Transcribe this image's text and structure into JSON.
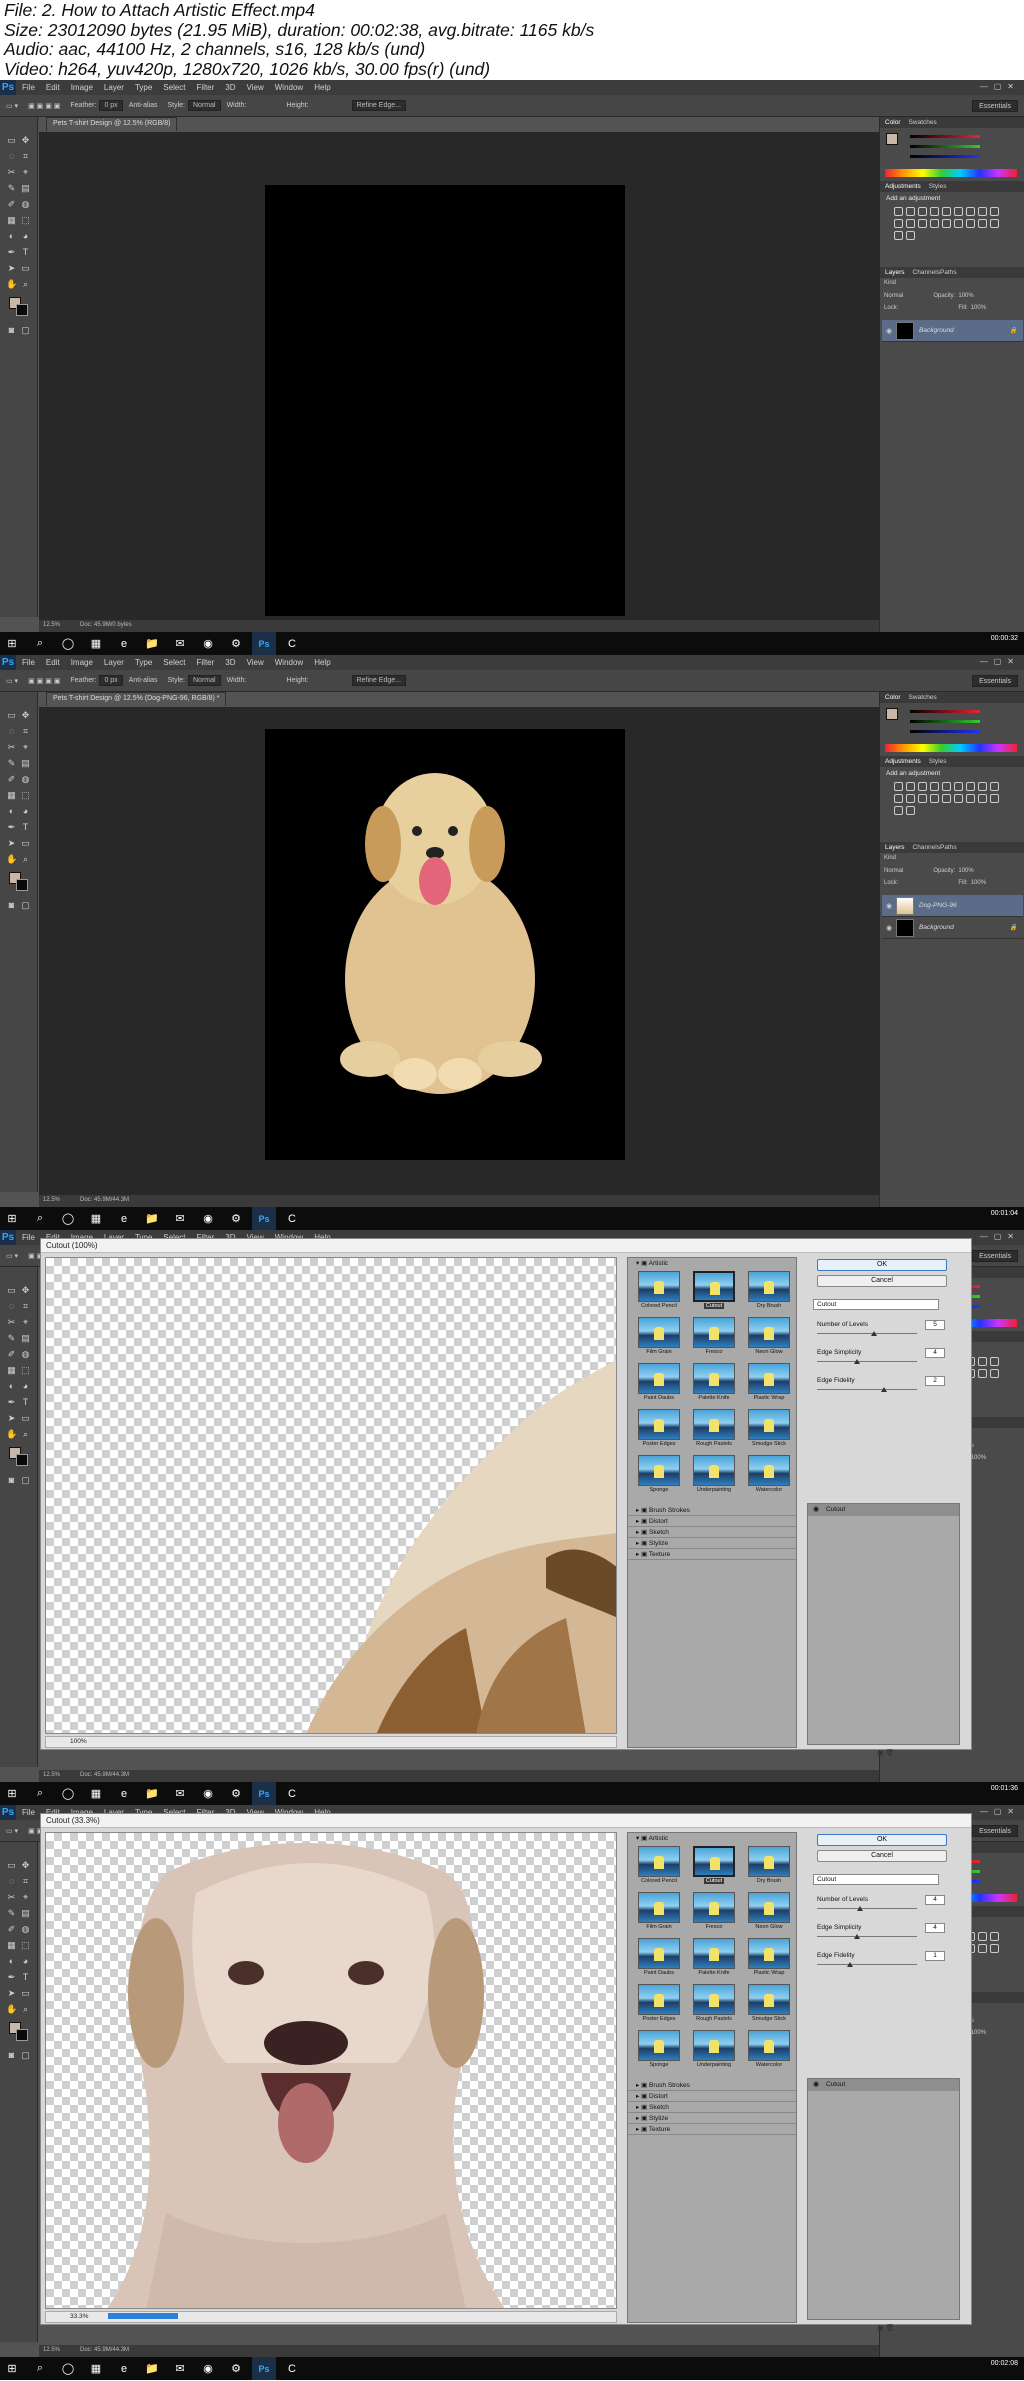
{
  "meta": {
    "lines": [
      "File: 2. How to Attach Artistic Effect.mp4",
      "Size: 23012090 bytes (21.95 MiB), duration: 00:02:38, avg.bitrate: 1165 kb/s",
      "Audio: aac, 44100 Hz, 2 channels, s16, 128 kb/s (und)",
      "Video: h264, yuv420p, 1280x720, 1026 kb/s, 30.00 fps(r) (und)"
    ]
  },
  "photoshop": {
    "logo": "Ps",
    "menu": [
      "File",
      "Edit",
      "Image",
      "Layer",
      "Type",
      "Select",
      "Filter",
      "3D",
      "View",
      "Window",
      "Help"
    ],
    "options": {
      "feather_label": "Feather:",
      "feather_value": "0 px",
      "antialias": "Anti-alias",
      "style_label": "Style:",
      "style_value": "Normal",
      "width_label": "Width:",
      "height_label": "Height:",
      "refine": "Refine Edge...",
      "workspace": "Essentials"
    },
    "panels": {
      "color_tab": "Color",
      "swatches_tab": "Swatches",
      "adjustments_tab": "Adjustments",
      "styles_tab": "Styles",
      "add_adjustment": "Add an adjustment",
      "layers_tab": "Layers",
      "channels_tab": "Channels",
      "paths_tab": "Paths",
      "kind": "Kind",
      "blend": "Normal",
      "opacity_label": "Opacity:",
      "opacity_value": "100%",
      "lock_label": "Lock:",
      "fill_label": "Fill:",
      "fill_value": "100%"
    },
    "status_zoom": "12.5%",
    "status_doc": "Doc: 45.9M/0 bytes",
    "status_doc2": "Doc: 45.9M/44.3M"
  },
  "frames": [
    {
      "doc_tab": "Pets T-shirt Design @ 12.5% (RGB/8)",
      "timecode": "00:00:32",
      "layers": [
        "Background"
      ]
    },
    {
      "doc_tab": "Pets T-shirt Design @ 12.5% (Dog-PNG-96, RGB/8) *",
      "timecode": "00:01:04",
      "layers": [
        "Dog-PNG-96",
        "Background"
      ]
    },
    {
      "dialog_title": "Cutout (100%)",
      "zoom": "100%",
      "timecode": "00:01:36",
      "params": {
        "levels": "5",
        "simplicity": "4",
        "fidelity": "2"
      },
      "levels_pos": 0.57,
      "simplicity_pos": 0.4,
      "fidelity_pos": 0.67
    },
    {
      "dialog_title": "Cutout (33.3%)",
      "zoom": "33.3%",
      "timecode": "00:02:08",
      "params": {
        "levels": "4",
        "simplicity": "4",
        "fidelity": "1"
      },
      "levels_pos": 0.43,
      "simplicity_pos": 0.4,
      "fidelity_pos": 0.33
    }
  ],
  "filter_gallery": {
    "ok": "OK",
    "cancel": "Cancel",
    "category_open": "Artistic",
    "filters": [
      "Colored Pencil",
      "Cutout",
      "Dry Brush",
      "Film Grain",
      "Fresco",
      "Neon Glow",
      "Paint Daubs",
      "Palette Knife",
      "Plastic Wrap",
      "Poster Edges",
      "Rough Pastels",
      "Smudge Stick",
      "Sponge",
      "Underpainting",
      "Watercolor"
    ],
    "categories": [
      "Brush Strokes",
      "Distort",
      "Sketch",
      "Stylize",
      "Texture"
    ],
    "selected": "Cutout",
    "param_labels": {
      "levels": "Number of Levels",
      "simplicity": "Edge Simplicity",
      "fidelity": "Edge Fidelity"
    },
    "applied_layer": "Cutout"
  },
  "colors": {
    "ps_bg": "#535353",
    "panel": "#4a4a4a",
    "canvas": "#282828",
    "taskbar": "#0c0c0c",
    "accent": "#31a8ff"
  }
}
